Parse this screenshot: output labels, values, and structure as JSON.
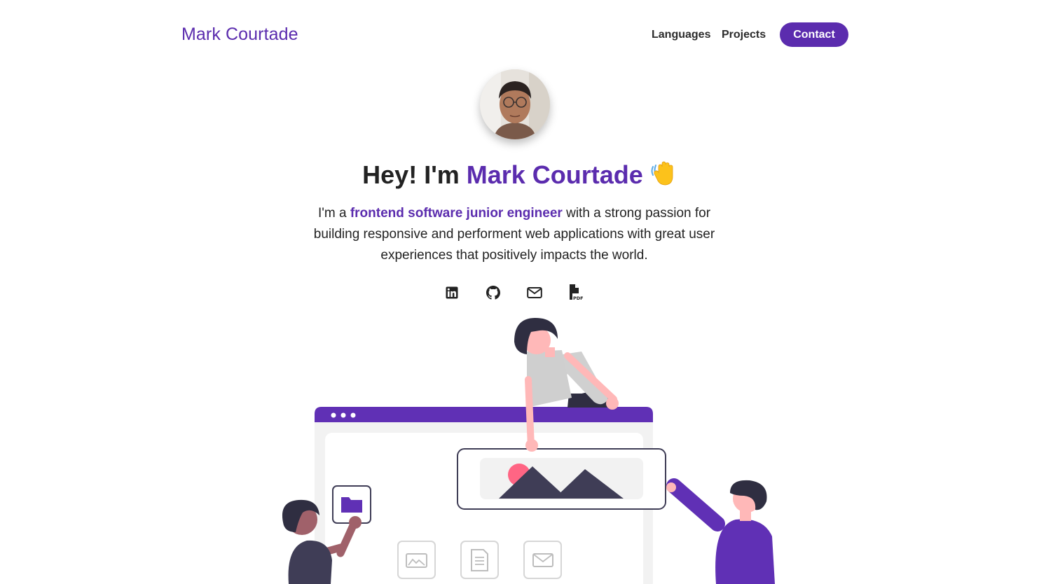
{
  "nav": {
    "brand": "Mark Courtade",
    "links": [
      {
        "label": "Languages"
      },
      {
        "label": "Projects"
      }
    ],
    "contact_label": "Contact"
  },
  "hero": {
    "greeting_prefix": "Hey! I'm ",
    "name": "Mark Courtade",
    "emoji": "waving-hand",
    "desc_prefix": "I'm a ",
    "desc_highlight": "frontend software junior engineer",
    "desc_suffix": " with a strong passion for building responsive and performent web applications with great user experiences that positively impacts the world."
  },
  "social_icons": [
    "linkedin-icon",
    "github-icon",
    "mail-icon",
    "pdf-resume-icon"
  ],
  "illustration_icons": [
    "folder-icon",
    "image-icon",
    "document-icon",
    "mail-icon"
  ],
  "colors": {
    "accent": "#5b2cae",
    "text": "#222222",
    "dark": "#3f3d56",
    "skin": "#ffb8b8",
    "pink": "#ff6584",
    "panel": "#f2f2f2"
  }
}
